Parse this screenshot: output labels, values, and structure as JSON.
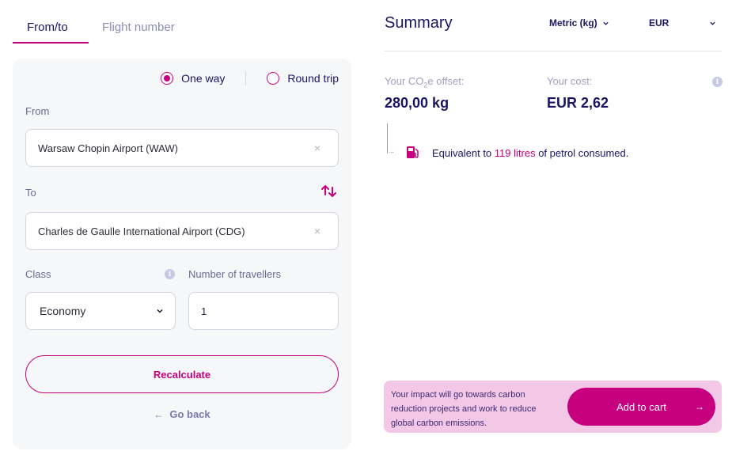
{
  "tabs": [
    {
      "label": "From/to",
      "active": true
    },
    {
      "label": "Flight number",
      "active": false
    }
  ],
  "trip_type": {
    "options": [
      {
        "label": "One way",
        "selected": true
      },
      {
        "label": "Round trip",
        "selected": false
      }
    ]
  },
  "form": {
    "from_label": "From",
    "from_value": "Warsaw Chopin Airport (WAW)",
    "to_label": "To",
    "to_value": "Charles de Gaulle International Airport (CDG)",
    "clear_glyph": "×",
    "class_label": "Class",
    "class_value": "Economy",
    "travellers_label": "Number of travellers",
    "travellers_value": "1",
    "info_glyph": "i",
    "recalculate_label": "Recalculate",
    "go_back_label": "Go back",
    "go_back_arrow": "←"
  },
  "summary": {
    "title": "Summary",
    "unit_select": "Metric (kg)",
    "currency_select": "EUR",
    "offset_label_pre": "Your CO",
    "offset_label_sub": "2",
    "offset_label_post": "e offset:",
    "offset_value": "280,00 kg",
    "cost_label": "Your cost:",
    "cost_value": "EUR 2,62",
    "info_glyph": "i",
    "equiv_pre": "Equivalent to ",
    "equiv_highlight": "119 litres",
    "equiv_post": " of petrol consumed.",
    "connector_arrow": "→"
  },
  "impact": {
    "text": "Your impact will go towards carbon reduction projects and work to reduce global carbon emissions.",
    "cart_label": "Add to cart",
    "cart_arrow": "→"
  },
  "colors": {
    "accent": "#c6007e",
    "navy": "#1a1464",
    "impact_bg": "#f3c8e6",
    "card_bg": "#f6f7f9"
  }
}
